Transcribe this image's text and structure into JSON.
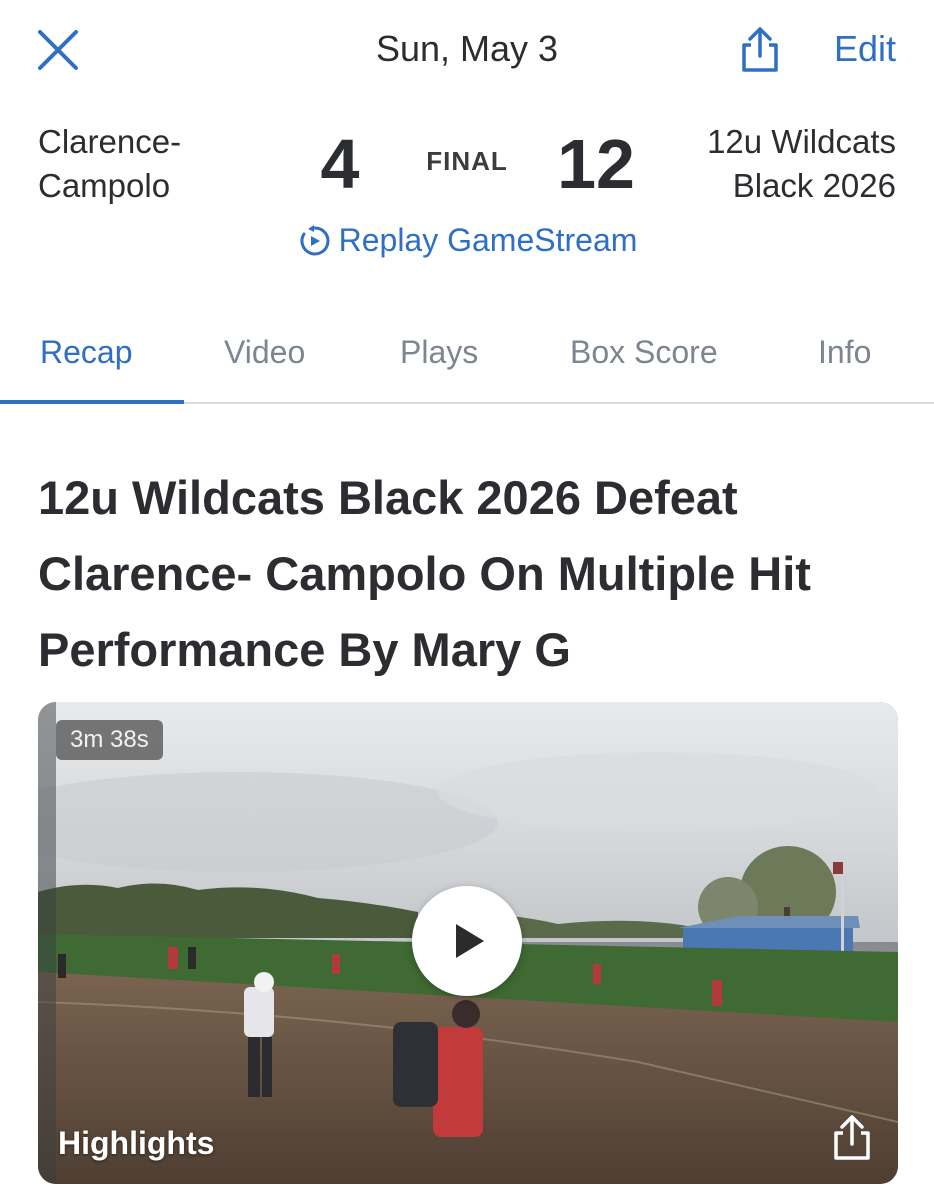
{
  "header": {
    "date": "Sun, May 3",
    "edit_label": "Edit",
    "close_icon": "close-icon",
    "share_icon": "share-icon",
    "accent_color": "#2f6fc4"
  },
  "game": {
    "away_team": "Clarence- Campolo",
    "away_score": "4",
    "status": "FINAL",
    "home_score": "12",
    "home_team": "12u Wildcats Black 2026",
    "replay_label": "Replay GameStream",
    "replay_icon": "replay-icon"
  },
  "tabs": [
    {
      "label": "Recap",
      "active": true
    },
    {
      "label": "Video",
      "active": false
    },
    {
      "label": "Plays",
      "active": false
    },
    {
      "label": "Box Score",
      "active": false
    },
    {
      "label": "Info",
      "active": false
    }
  ],
  "recap": {
    "headline": "12u Wildcats Black 2026 Defeat Clarence- Campolo On Multiple Hit Performance By Mary G"
  },
  "video": {
    "duration": "3m 38s",
    "title": "Highlights",
    "play_icon": "play-icon",
    "share_icon": "share-icon"
  }
}
